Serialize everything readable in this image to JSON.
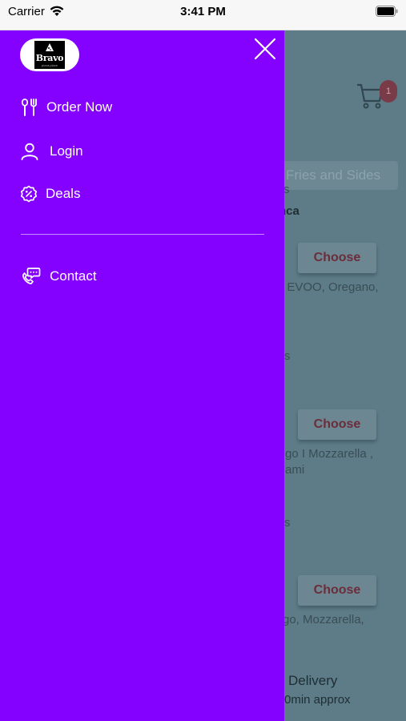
{
  "status_bar": {
    "carrier": "Carrier",
    "time": "3:41 PM"
  },
  "drawer": {
    "logo": {
      "brand": "Bravo",
      "tagline": "pizza place"
    },
    "menu": [
      {
        "label": "Order Now",
        "icon": "utensils-icon"
      },
      {
        "label": "Login",
        "icon": "user-icon"
      },
      {
        "label": "Deals",
        "icon": "discount-badge-icon"
      }
    ],
    "secondary_menu": [
      {
        "label": "Contact",
        "icon": "phone-chat-icon"
      }
    ],
    "background_color": "#8400ff"
  },
  "background_app": {
    "cart_count": "1",
    "search_text": "Fries and Sides",
    "fragments": {
      "f1": "s",
      "f2": "nca",
      "f3": ", EVOO, Oregano,",
      "f4": "s",
      "f5": "go I Mozzarella ,",
      "f6": "ami",
      "f7": "s",
      "f8": "go, Mozzarella,",
      "f9": "Delivery",
      "f10": "0min approx"
    },
    "choose_label": "Choose"
  }
}
